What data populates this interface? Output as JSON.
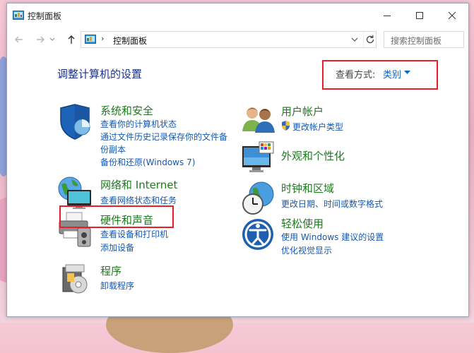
{
  "window": {
    "title": "控制面板",
    "address": "控制面板",
    "address_sep": "›",
    "search_placeholder": "搜索控制面板"
  },
  "content": {
    "heading": "调整计算机的设置",
    "view_by_label": "查看方式:",
    "view_by_value": "类别"
  },
  "categories": {
    "system": {
      "title": "系统和安全",
      "links": [
        "查看你的计算机状态",
        "通过文件历史记录保存你的文件备",
        "份副本",
        "备份和还原(Windows 7)"
      ]
    },
    "network": {
      "title": "网络和 Internet",
      "links": [
        "查看网络状态和任务"
      ]
    },
    "hardware": {
      "title": "硬件和声音",
      "links": [
        "查看设备和打印机",
        "添加设备"
      ]
    },
    "programs": {
      "title": "程序",
      "links": [
        "卸载程序"
      ]
    },
    "users": {
      "title": "用户帐户",
      "links": [
        "更改帐户类型"
      ]
    },
    "appearance": {
      "title": "外观和个性化",
      "links": []
    },
    "clock": {
      "title": "时钟和区域",
      "links": [
        "更改日期、时间或数字格式"
      ]
    },
    "ease": {
      "title": "轻松使用",
      "links": [
        "使用 Windows 建议的设置",
        "优化视觉显示"
      ]
    }
  },
  "colors": {
    "category_title": "#1f7a1f",
    "link": "#1558b0",
    "heading": "#1e3287",
    "highlight": "#e5202a"
  }
}
